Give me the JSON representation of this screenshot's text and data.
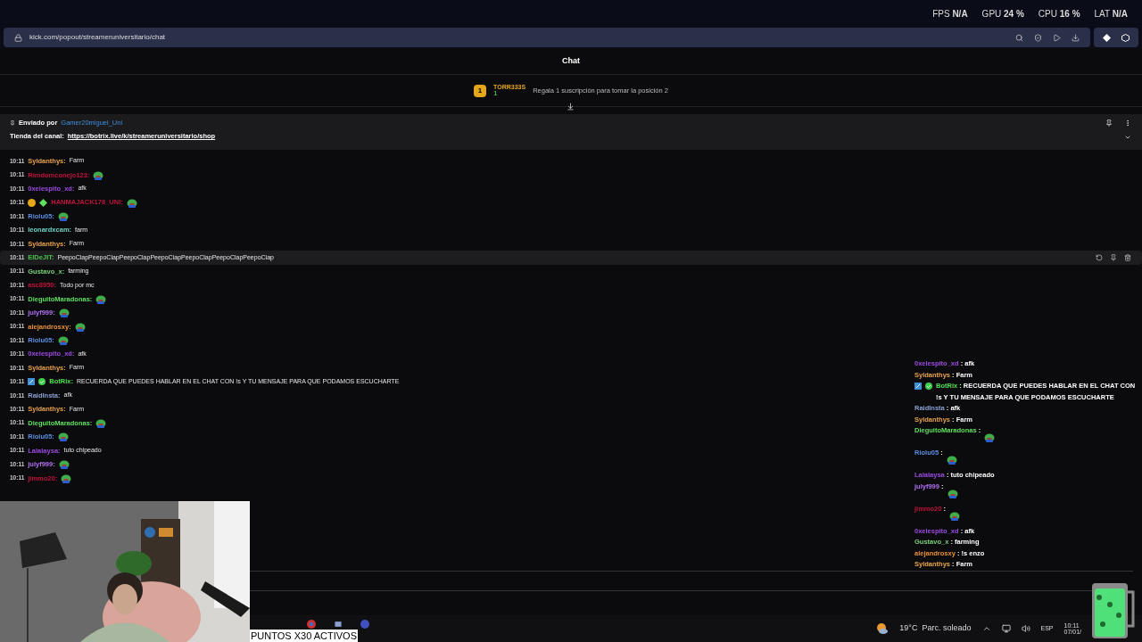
{
  "stats": [
    {
      "label": "FPS",
      "value": "N/A"
    },
    {
      "label": "GPU",
      "value": "24 %"
    },
    {
      "label": "CPU",
      "value": "16 %"
    },
    {
      "label": "LAT",
      "value": "N/A"
    }
  ],
  "browser": {
    "url": "kick.com/popout/streameruniversitario/chat"
  },
  "chat_header": {
    "title": "Chat"
  },
  "leaderboard": {
    "rank": "1",
    "user": "TORR333S",
    "count": "1",
    "hint": "Regala 1 suscripción para tomar la posición 2"
  },
  "pinned": {
    "sent_by": "Enviado por",
    "author": "Gamer20miguel_Uni",
    "label": "Tienda del canal:",
    "link": "https://botrix.live/k/streameruniversitario/shop"
  },
  "messages": [
    {
      "time": "10:11",
      "user": "Syldanthys:",
      "color": "#e8a24a",
      "kind": "text",
      "text": "Farm",
      "selected": false
    },
    {
      "time": "10:11",
      "user": "Rimdomconejo123:",
      "color": "#c0143c",
      "kind": "emote",
      "selected": false
    },
    {
      "time": "10:11",
      "user": "0xelespito_xd:",
      "color": "#9a4be0",
      "kind": "text",
      "text": "afk",
      "selected": false
    },
    {
      "time": "10:11",
      "user": "HANMAJACK178_UNI:",
      "color": "#c0143c",
      "kind": "emote",
      "badges": [
        {
          "kind": "coin"
        },
        {
          "kind": "gem"
        }
      ],
      "selected": false
    },
    {
      "time": "10:11",
      "user": "Riolu05:",
      "color": "#5b8fe0",
      "kind": "emote",
      "selected": false
    },
    {
      "time": "10:11",
      "user": "leonardxcam:",
      "color": "#6fd0c0",
      "kind": "text",
      "text": "farm",
      "selected": false
    },
    {
      "time": "10:11",
      "user": "Syldanthys:",
      "color": "#e8a24a",
      "kind": "text",
      "text": "Farm",
      "selected": false
    },
    {
      "time": "10:11",
      "user": "ElDeJIT:",
      "color": "#4ec24e",
      "kind": "text",
      "text": "PeepoClapPeepoClapPeepoClapPeepoClapPeepoClapPeepoClapPeepoClap",
      "selected": true
    },
    {
      "time": "10:11",
      "user": "Gustavo_x:",
      "color": "#7ad07a",
      "kind": "text",
      "text": "farming",
      "selected": false
    },
    {
      "time": "10:11",
      "user": "asc8950:",
      "color": "#c0143c",
      "kind": "text",
      "text": "Todo por mc",
      "selected": false
    },
    {
      "time": "10:11",
      "user": "DieguitoMaradonas:",
      "color": "#5fe05f",
      "kind": "emote",
      "selected": false
    },
    {
      "time": "10:11",
      "user": "julyf999:",
      "color": "#b070f0",
      "kind": "emote",
      "selected": false
    },
    {
      "time": "10:11",
      "user": "alejandrosxy:",
      "color": "#e8903a",
      "kind": "emote",
      "selected": false
    },
    {
      "time": "10:11",
      "user": "Riolu05:",
      "color": "#5b8fe0",
      "kind": "emote",
      "selected": false
    },
    {
      "time": "10:11",
      "user": "0xelespito_xd:",
      "color": "#9a4be0",
      "kind": "text",
      "text": "afk",
      "selected": false
    },
    {
      "time": "10:11",
      "user": "Syldanthys:",
      "color": "#e8a24a",
      "kind": "text",
      "text": "Farm",
      "selected": false
    },
    {
      "time": "10:11",
      "user": "BotRix:",
      "color": "#4ee04e",
      "kind": "text",
      "text": "RECUERDA QUE PUEDES HABLAR EN EL CHAT CON !s Y TU MENSAJE PARA QUE PODAMOS ESCUCHARTE",
      "badges": [
        {
          "kind": "bot"
        },
        {
          "kind": "verified"
        }
      ],
      "selected": false
    },
    {
      "time": "10:11",
      "user": "RaidInsta:",
      "color": "#8aa0d0",
      "kind": "text",
      "text": "afk",
      "selected": false
    },
    {
      "time": "10:11",
      "user": "Syldanthys:",
      "color": "#e8a24a",
      "kind": "text",
      "text": "Farm",
      "selected": false
    },
    {
      "time": "10:11",
      "user": "DieguitoMaradonas:",
      "color": "#5fe05f",
      "kind": "emote",
      "selected": false
    },
    {
      "time": "10:11",
      "user": "Riolu05:",
      "color": "#5b8fe0",
      "kind": "emote",
      "selected": false
    },
    {
      "time": "10:11",
      "user": "Lalalaysa:",
      "color": "#9a4be0",
      "kind": "text",
      "text": "tuto chipeado",
      "selected": false
    },
    {
      "time": "10:11",
      "user": "julyf999:",
      "color": "#b070f0",
      "kind": "emote",
      "selected": false
    },
    {
      "time": "10:11",
      "user": "jimmo20:",
      "color": "#c0143c",
      "kind": "emote",
      "selected": false
    }
  ],
  "overlay_chat": [
    {
      "user": "0xelespito_xd",
      "color": "#9a4be0",
      "kind": "text",
      "text": ": afk"
    },
    {
      "user": "Syldanthys",
      "color": "#e8a24a",
      "kind": "text",
      "text": ": Farm"
    },
    {
      "user": "BotRix",
      "color": "#4ee04e",
      "kind": "text",
      "text": ": RECUERDA QUE PUEDES HABLAR EN EL CHAT CON !s Y TU MENSAJE PARA QUE PODAMOS ESCUCHARTE",
      "badges": [
        {
          "kind": "bot"
        },
        {
          "kind": "verified"
        }
      ]
    },
    {
      "user": "RaidInsta",
      "color": "#8aa0d0",
      "kind": "text",
      "text": ": afk"
    },
    {
      "user": "Syldanthys",
      "color": "#e8a24a",
      "kind": "text",
      "text": ": Farm"
    },
    {
      "user": "DieguitoMaradonas",
      "color": "#5fe05f",
      "kind": "emote",
      "text": ":"
    },
    {
      "user": "Riolu05",
      "color": "#5b8fe0",
      "kind": "emote",
      "text": ":"
    },
    {
      "user": "Lalalaysa",
      "color": "#9a4be0",
      "kind": "text",
      "text": ": tuto chipeado"
    },
    {
      "user": "julyf999",
      "color": "#b070f0",
      "kind": "emote",
      "text": ":"
    },
    {
      "user": "jimmo20",
      "color": "#c0143c",
      "kind": "emote",
      "text": ":"
    },
    {
      "user": "0xelespito_xd",
      "color": "#9a4be0",
      "kind": "text",
      "text": ": afk"
    },
    {
      "user": "Gustavo_x",
      "color": "#7ad07a",
      "kind": "text",
      "text": ": farming"
    },
    {
      "user": "alejandrosxy",
      "color": "#e8903a",
      "kind": "text",
      "text": ": !s enzo"
    },
    {
      "user": "Syldanthys",
      "color": "#e8a24a",
      "kind": "text",
      "text": ": Farm"
    }
  ],
  "banner": "PUNTOS X30 ACTIVOS",
  "taskbar": {
    "weather": "19°C  Parc. soleado",
    "language": "ESP",
    "time": "10:11",
    "date": "07/01/"
  }
}
